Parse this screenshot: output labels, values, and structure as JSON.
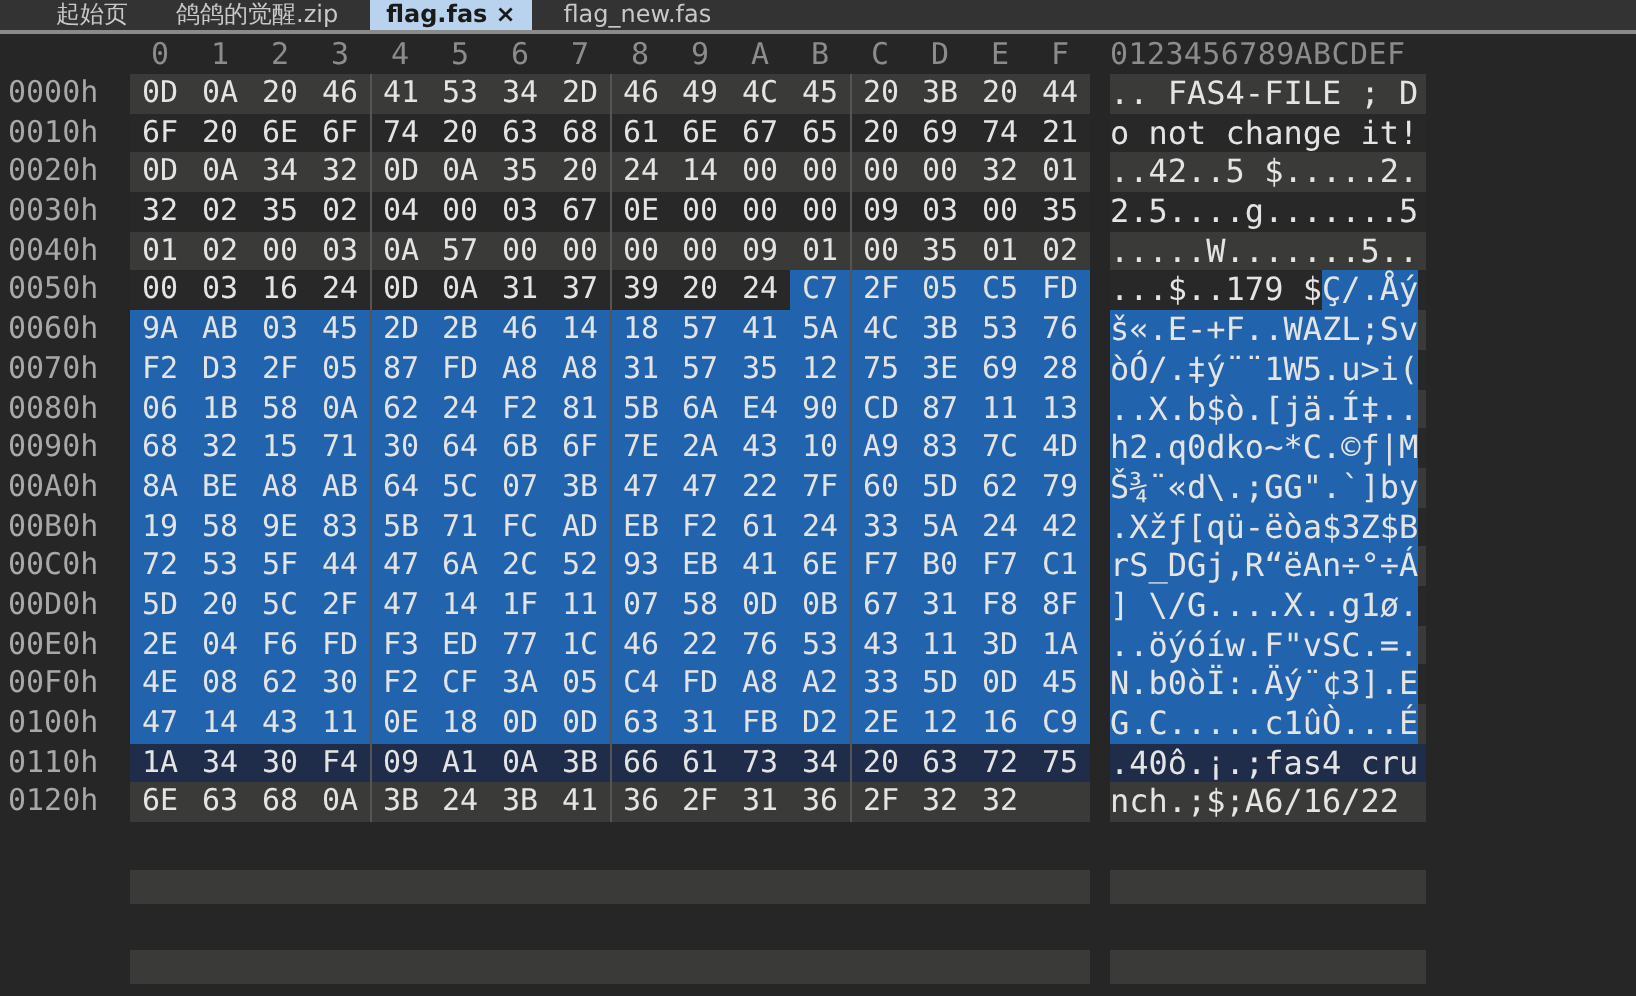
{
  "tabs": [
    {
      "label": "起始页",
      "selected": false
    },
    {
      "label": "鸽鸽的觉醒.zip",
      "selected": false
    },
    {
      "label": "flag.fas",
      "selected": true,
      "close": "×"
    },
    {
      "label": "flag_new.fas",
      "selected": false
    }
  ],
  "hex_header": [
    "0",
    "1",
    "2",
    "3",
    "4",
    "5",
    "6",
    "7",
    "8",
    "9",
    "A",
    "B",
    "C",
    "D",
    "E",
    "F"
  ],
  "ascii_header": "0123456789ABCDEF",
  "rows": [
    {
      "offset": "0000h",
      "current": false,
      "hex": [
        {
          "bytes": "0D 0A 20 46 41 53 34 2D 46 49 4C 45 20 3B 20 44",
          "selected": false
        }
      ],
      "ascii": [
        {
          "text": ".. FAS4-FILE ; D",
          "selected": false
        }
      ]
    },
    {
      "offset": "0010h",
      "current": false,
      "hex": [
        {
          "bytes": "6F 20 6E 6F 74 20 63 68 61 6E 67 65 20 69 74 21",
          "selected": false
        }
      ],
      "ascii": [
        {
          "text": "o not change it!",
          "selected": false
        }
      ]
    },
    {
      "offset": "0020h",
      "current": false,
      "hex": [
        {
          "bytes": "0D 0A 34 32 0D 0A 35 20 24 14 00 00 00 00 32 01",
          "selected": false
        }
      ],
      "ascii": [
        {
          "text": "..42..5 $.....2.",
          "selected": false
        }
      ]
    },
    {
      "offset": "0030h",
      "current": false,
      "hex": [
        {
          "bytes": "32 02 35 02 04 00 03 67 0E 00 00 00 09 03 00 35",
          "selected": false
        }
      ],
      "ascii": [
        {
          "text": "2.5....g.......5",
          "selected": false
        }
      ]
    },
    {
      "offset": "0040h",
      "current": false,
      "hex": [
        {
          "bytes": "01 02 00 03 0A 57 00 00 00 00 09 01 00 35 01 02",
          "selected": false
        }
      ],
      "ascii": [
        {
          "text": ".....W.......5..",
          "selected": false
        }
      ]
    },
    {
      "offset": "0050h",
      "current": false,
      "hex": [
        {
          "bytes": "00 03 16 24 0D 0A 31 37 39 20 24",
          "selected": false
        },
        {
          "bytes": "C7 2F 05 C5 FD",
          "selected": true
        }
      ],
      "ascii": [
        {
          "text": "...$..179 $",
          "selected": false
        },
        {
          "text": "Ç/.Åý",
          "selected": true
        }
      ]
    },
    {
      "offset": "0060h",
      "current": false,
      "hex": [
        {
          "bytes": "9A AB 03 45 2D 2B 46 14 18 57 41 5A 4C 3B 53 76",
          "selected": true
        }
      ],
      "ascii": [
        {
          "text": "š«.E-+F..WAZL;Sv",
          "selected": true
        }
      ]
    },
    {
      "offset": "0070h",
      "current": false,
      "hex": [
        {
          "bytes": "F2 D3 2F 05 87 FD A8 A8 31 57 35 12 75 3E 69 28",
          "selected": true
        }
      ],
      "ascii": [
        {
          "text": "òÓ/.‡ý¨¨1W5.u>i(",
          "selected": true
        }
      ]
    },
    {
      "offset": "0080h",
      "current": false,
      "hex": [
        {
          "bytes": "06 1B 58 0A 62 24 F2 81 5B 6A E4 90 CD 87 11 13",
          "selected": true
        }
      ],
      "ascii": [
        {
          "text": "..X.b$ò.[jä.Í‡..",
          "selected": true
        }
      ]
    },
    {
      "offset": "0090h",
      "current": false,
      "hex": [
        {
          "bytes": "68 32 15 71 30 64 6B 6F 7E 2A 43 10 A9 83 7C 4D",
          "selected": true
        }
      ],
      "ascii": [
        {
          "text": "h2.q0dko~*C.©ƒ|M",
          "selected": true
        }
      ]
    },
    {
      "offset": "00A0h",
      "current": false,
      "hex": [
        {
          "bytes": "8A BE A8 AB 64 5C 07 3B 47 47 22 7F 60 5D 62 79",
          "selected": true
        }
      ],
      "ascii": [
        {
          "text": "Š¾¨«d\\.;GG\".`]by",
          "selected": true
        }
      ]
    },
    {
      "offset": "00B0h",
      "current": false,
      "hex": [
        {
          "bytes": "19 58 9E 83 5B 71 FC AD EB F2 61 24 33 5A 24 42",
          "selected": true
        }
      ],
      "ascii": [
        {
          "text": ".Xžƒ[qü-ëòa$3Z$B",
          "selected": true
        }
      ]
    },
    {
      "offset": "00C0h",
      "current": false,
      "hex": [
        {
          "bytes": "72 53 5F 44 47 6A 2C 52 93 EB 41 6E F7 B0 F7 C1",
          "selected": true
        }
      ],
      "ascii": [
        {
          "text": "rS_DGj,R“ëAn÷°÷Á",
          "selected": true
        }
      ]
    },
    {
      "offset": "00D0h",
      "current": false,
      "hex": [
        {
          "bytes": "5D 20 5C 2F 47 14 1F 11 07 58 0D 0B 67 31 F8 8F",
          "selected": true
        }
      ],
      "ascii": [
        {
          "text": "] \\/G....X..g1ø.",
          "selected": true
        }
      ]
    },
    {
      "offset": "00E0h",
      "current": false,
      "hex": [
        {
          "bytes": "2E 04 F6 FD F3 ED 77 1C 46 22 76 53 43 11 3D 1A",
          "selected": true
        }
      ],
      "ascii": [
        {
          "text": "..öýóíw.F\"vSC.=.",
          "selected": true
        }
      ]
    },
    {
      "offset": "00F0h",
      "current": false,
      "hex": [
        {
          "bytes": "4E 08 62 30 F2 CF 3A 05 C4 FD A8 A2 33 5D 0D 45",
          "selected": true
        }
      ],
      "ascii": [
        {
          "text": "N.b0òÏ:.Äý¨¢3].E",
          "selected": true
        }
      ]
    },
    {
      "offset": "0100h",
      "current": false,
      "hex": [
        {
          "bytes": "47 14 43 11 0E 18 0D 0D 63 31 FB D2 2E 12 16 C9",
          "selected": true
        }
      ],
      "ascii": [
        {
          "text": "G.C.....c1ûÒ...É",
          "selected": true
        }
      ]
    },
    {
      "offset": "0110h",
      "current": true,
      "hex": [
        {
          "bytes": "1A 34 30 F4 09 A1 0A 3B 66 61 73 34 20 63 72 75",
          "selected": false
        }
      ],
      "ascii": [
        {
          "text": ".40ô.¡.;fas4 cru",
          "selected": false
        }
      ]
    },
    {
      "offset": "0120h",
      "current": false,
      "hex": [
        {
          "bytes": "6E 63 68 0A 3B 24 3B 41 36 2F 31 36 2F 32 32",
          "selected": false
        }
      ],
      "ascii": [
        {
          "text": "nch.;$;A6/16/22",
          "selected": false
        }
      ]
    }
  ]
}
